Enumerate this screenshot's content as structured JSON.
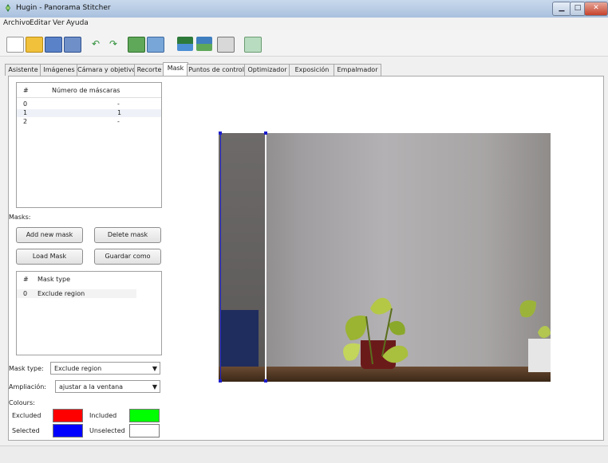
{
  "window": {
    "title": "Hugin - Panorama Stitcher"
  },
  "menu": [
    {
      "label": "Archivo",
      "x": 4
    },
    {
      "label": "Editar",
      "x": 37
    },
    {
      "label": "Ver",
      "x": 66
    },
    {
      "label": "Ayuda",
      "x": 83
    }
  ],
  "tabs": [
    {
      "label": "Asistente"
    },
    {
      "label": "Imágenes"
    },
    {
      "label": "Cámara y objetivo"
    },
    {
      "label": "Recorte"
    },
    {
      "label": "Mask"
    },
    {
      "label": "Puntos de control"
    },
    {
      "label": "Optimizador"
    },
    {
      "label": "Exposición"
    },
    {
      "label": "Empalmador"
    }
  ],
  "images_list": {
    "col_hash": "#",
    "col_count": "Número de máscaras",
    "rows": [
      {
        "idx": "0",
        "count": "-"
      },
      {
        "idx": "1",
        "count": "1"
      },
      {
        "idx": "2",
        "count": "-"
      }
    ]
  },
  "masks_label": "Masks:",
  "buttons": {
    "add_new_mask": "Add new mask",
    "delete_mask": "Delete mask",
    "load_mask": "Load Mask",
    "save_as": "Guardar como"
  },
  "mask_list": {
    "col_hash": "#",
    "col_type": "Mask type",
    "rows": [
      {
        "idx": "0",
        "type": "Exclude region"
      }
    ]
  },
  "mask_type": {
    "label": "Mask type:",
    "value": "Exclude region"
  },
  "zoom": {
    "label": "Ampliación:",
    "value": "ajustar a la ventana"
  },
  "colours": {
    "label": "Colours:",
    "excluded": "Excluded",
    "included": "Included",
    "selected": "Selected",
    "unselected": "Unselected",
    "excluded_color": "#ff0000",
    "included_color": "#00ff00",
    "selected_color": "#0000ff",
    "unselected_color": "#ffffff"
  }
}
